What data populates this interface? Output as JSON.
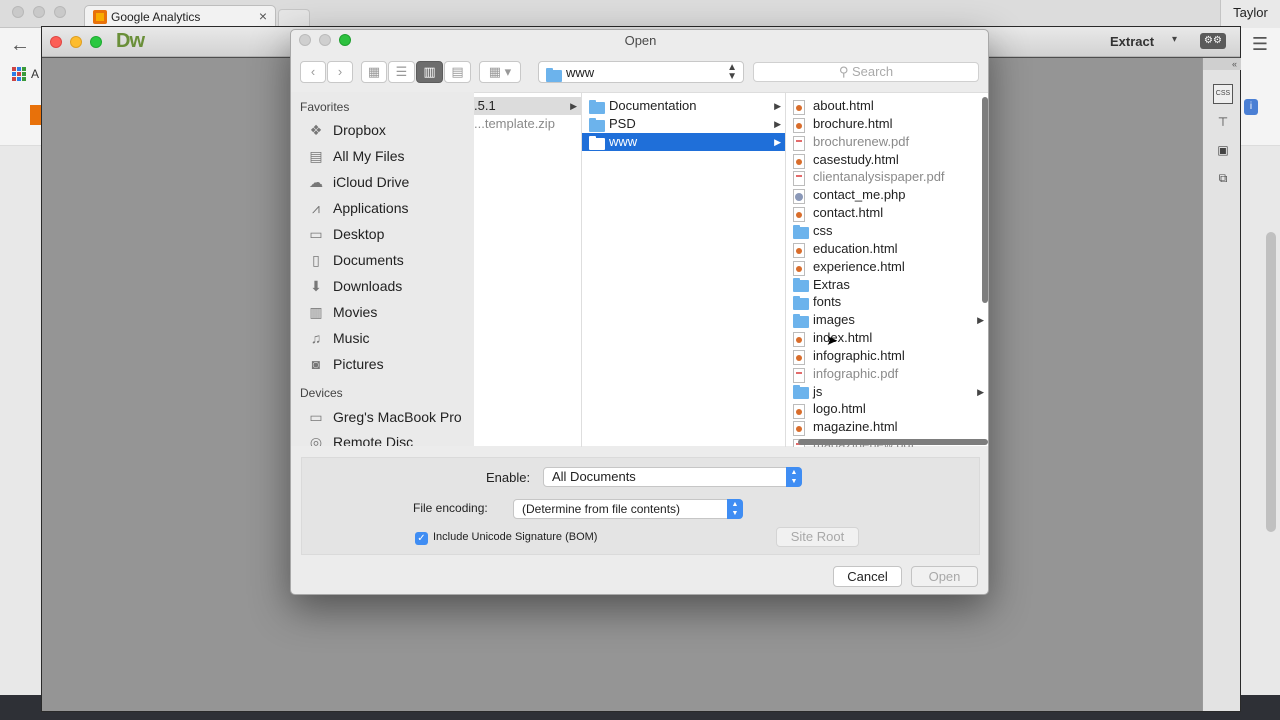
{
  "browser": {
    "tab_title": "Google Analytics",
    "tab_close": "×",
    "user": "Taylor",
    "bookmark_label": "A",
    "badge": "i"
  },
  "dreamweaver": {
    "logo": "Dw",
    "workspace_label": "Extract",
    "workspace_caret": "▾",
    "panel_collapse": "«",
    "panel_css_label": "CSS"
  },
  "dialog": {
    "title": "Open",
    "path": "www",
    "search_placeholder": "Search",
    "sidebar": {
      "favorites_header": "Favorites",
      "favorites": [
        "Dropbox",
        "All My Files",
        "iCloud Drive",
        "Applications",
        "Desktop",
        "Documents",
        "Downloads",
        "Movies",
        "Music",
        "Pictures"
      ],
      "devices_header": "Devices",
      "devices": [
        "Greg's MacBook Pro",
        "Remote Disc"
      ]
    },
    "column1": [
      ".5.1",
      "...template.zip"
    ],
    "column2": [
      "Documentation",
      "PSD",
      "www"
    ],
    "column3": [
      {
        "name": "about.html",
        "kind": "html"
      },
      {
        "name": "brochure.html",
        "kind": "html"
      },
      {
        "name": "brochurenew.pdf",
        "kind": "pdf"
      },
      {
        "name": "casestudy.html",
        "kind": "html"
      },
      {
        "name": "clientanalysispaper.pdf",
        "kind": "pdf"
      },
      {
        "name": "contact_me.php",
        "kind": "php"
      },
      {
        "name": "contact.html",
        "kind": "html"
      },
      {
        "name": "css",
        "kind": "folder"
      },
      {
        "name": "education.html",
        "kind": "html"
      },
      {
        "name": "experience.html",
        "kind": "html"
      },
      {
        "name": "Extras",
        "kind": "folder"
      },
      {
        "name": "fonts",
        "kind": "folder"
      },
      {
        "name": "images",
        "kind": "folder"
      },
      {
        "name": "index.html",
        "kind": "html"
      },
      {
        "name": "infographic.html",
        "kind": "html"
      },
      {
        "name": "infographic.pdf",
        "kind": "pdf"
      },
      {
        "name": "js",
        "kind": "folder"
      },
      {
        "name": "logo.html",
        "kind": "html"
      },
      {
        "name": "magazine.html",
        "kind": "html"
      },
      {
        "name": "magazinenew.pdf",
        "kind": "pdf"
      }
    ],
    "options": {
      "enable_label": "Enable:",
      "enable_value": "All Documents",
      "encoding_label": "File encoding:",
      "encoding_value": "(Determine from file contents)",
      "bom_label": "Include Unicode Signature (BOM)",
      "bom_checked": true,
      "site_root": "Site Root"
    },
    "buttons": {
      "cancel": "Cancel",
      "open": "Open"
    }
  },
  "colors": {
    "selection": "#1f6fd9",
    "accent": "#3f8df3",
    "folder": "#6cb3ec"
  }
}
